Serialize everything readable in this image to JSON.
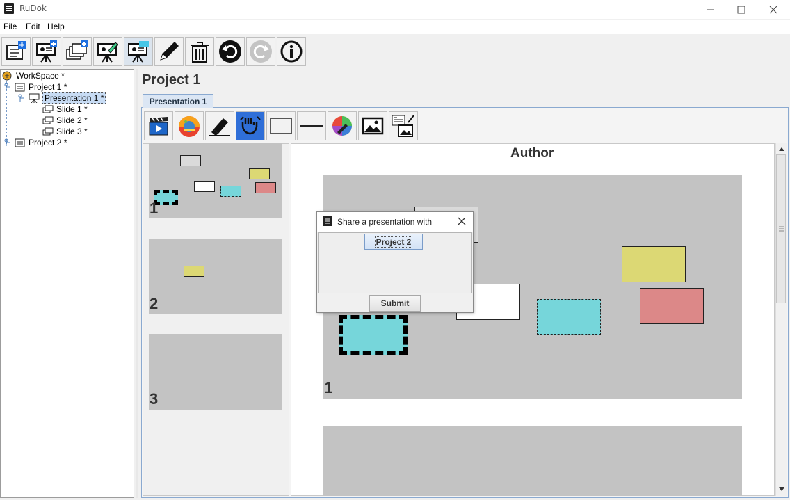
{
  "window": {
    "title": "RuDok"
  },
  "menu": {
    "items": [
      "File",
      "Edit",
      "Help"
    ]
  },
  "toolbar": {
    "buttons": [
      "new-project-icon",
      "new-presentation-icon",
      "new-slide-icon",
      "edit-presentation-icon",
      "share-presentation-icon",
      "rename-pencil-icon",
      "delete-trash-icon",
      "undo-icon",
      "redo-icon",
      "info-icon"
    ]
  },
  "tree": {
    "workspace": "WorkSpace *",
    "project1": "Project 1 *",
    "presentation1": "Presentation 1 *",
    "slide1": "Slide 1 *",
    "slide2": "Slide 2 *",
    "slide3": "Slide 3 *",
    "project2": "Project 2 *"
  },
  "main": {
    "project_title": "Project 1",
    "tab": "Presentation 1",
    "author": "Author",
    "inner_toolbar": [
      "slideshow-clapper-icon",
      "theme-palette-icon",
      "highlighter-icon",
      "hand-select-icon",
      "rectangle-tool-icon",
      "line-tool-icon",
      "color-picker-icon",
      "image-tool-icon",
      "text-image-tool-icon"
    ],
    "thumbnails": [
      "1",
      "2",
      "3"
    ],
    "slide_number": "1"
  },
  "colors": {
    "yellow": "#dcd874",
    "cyan": "#76d6da",
    "red": "#dc8888",
    "slide_bg": "#c3c3c3"
  },
  "dialog": {
    "title": "Share a presentation with",
    "option": "Project 2",
    "submit": "Submit"
  }
}
